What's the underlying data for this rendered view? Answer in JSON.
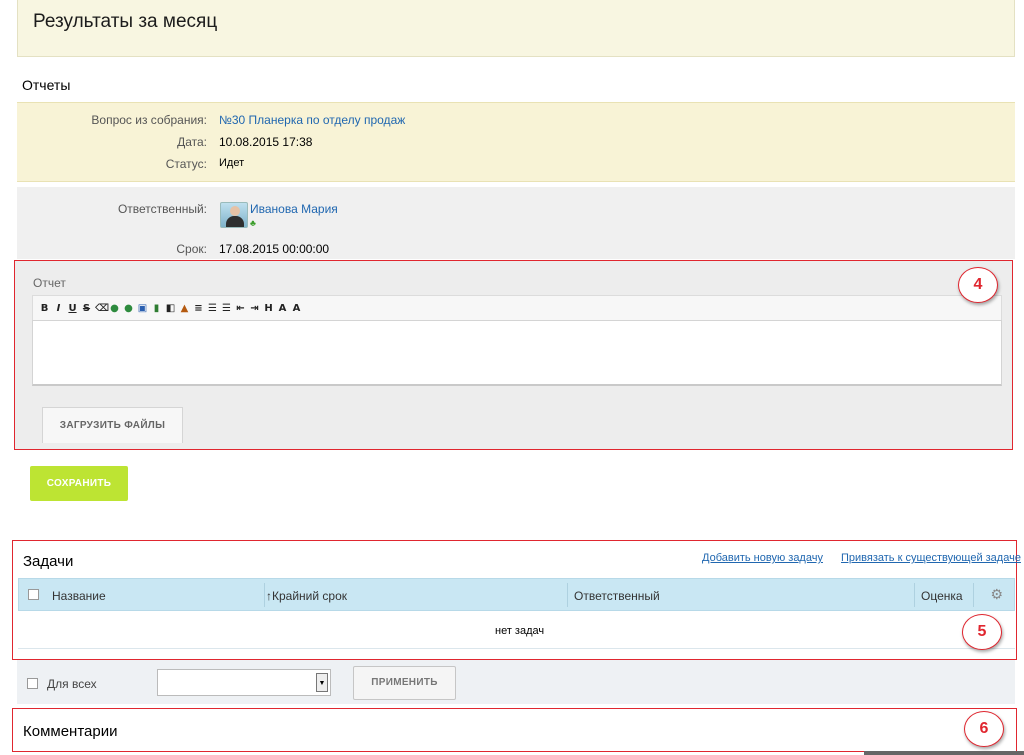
{
  "page": {
    "title": "Результаты за месяц"
  },
  "reports": {
    "heading": "Отчеты",
    "question_label": "Вопрос из собрания:",
    "question_value": "№30 Планерка по отделу продаж",
    "date_label": "Дата:",
    "date_value": "10.08.2015 17:38",
    "status_label": "Статус:",
    "status_value": "Идет",
    "responsible_label": "Ответственный:",
    "responsible_value": "Иванова Мария",
    "deadline_label": "Срок:",
    "deadline_value": "17.08.2015 00:00:00"
  },
  "report_editor": {
    "label": "Отчет",
    "toolbar": [
      "B",
      "I",
      "U",
      "S"
    ],
    "upload_label": "ЗАГРУЗИТЬ ФАЙЛЫ"
  },
  "save_label": "СОХРАНИТЬ",
  "markers": {
    "m4": "4",
    "m5": "5",
    "m6": "6"
  },
  "tasks": {
    "heading": "Задачи",
    "add_link": "Добавить новую задачу",
    "attach_link": "Привязать к существующей задаче",
    "columns": {
      "name": "Название",
      "deadline": "↑Крайний срок",
      "responsible": "Ответственный",
      "rating": "Оценка"
    },
    "empty": "нет задач"
  },
  "footer": {
    "for_all_label": "Для всех",
    "select_value": "",
    "apply_label": "ПРИМЕНИТЬ"
  },
  "comments": {
    "heading": "Комментарии"
  },
  "colors": {
    "accent_red": "#e0262f",
    "save_green": "#bde433",
    "link_blue": "#2067b0",
    "grid_header": "#c9e7f3"
  }
}
